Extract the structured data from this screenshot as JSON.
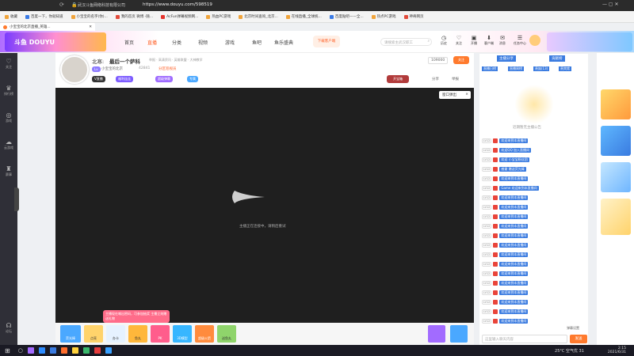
{
  "browser": {
    "url": "https://www.douyu.com/598519",
    "company": "武汉斗鱼网络科技有限公司"
  },
  "bookmarks": [
    "收藏",
    "百度一下，你就知道",
    "小宝宝的名字(你)...",
    "我的首页 微博 -随...",
    "AcFun弹幕视频网...",
    "热血PC游戏",
    "北京时间查询_北京...",
    "在线直播_全球统...",
    "百度贴吧——全...",
    "热点PC游戏",
    "神奇网页"
  ],
  "tab": {
    "title": "小宝宝的北京直播_英雄..."
  },
  "site_nav": {
    "links": [
      "首页",
      "直播",
      "分类",
      "视频",
      "游戏",
      "鱼吧",
      "鱼乐盛典"
    ],
    "search_placeholder": "请搜索主武汉职工",
    "download": "下载客户端",
    "icons": [
      "历史",
      "关注",
      "开播",
      "客户端",
      "消息",
      "任务中心"
    ]
  },
  "rail": [
    "关注",
    "排行榜",
    "游戏",
    "云游戏",
    "赛事",
    "论坛"
  ],
  "room": {
    "title_prefix": "北寒:",
    "title": "最后一个萨科",
    "subtitle": "举报 · 高清资讯 · 英雄联盟 · 大神教学",
    "streamer": "小宝宝的北京",
    "followers_label": "42841",
    "fans_badge": "分区巡视员",
    "follow_button": "关注",
    "fans_count": "109000",
    "share": "分享",
    "report": "举报",
    "live_badge": "V直播",
    "tags": [
      "福利连连",
      "超级弹幕",
      "专属"
    ],
    "treasure": "开宝箱"
  },
  "player": {
    "popout": "窗口弹出",
    "close": "×",
    "loading_text": "主播正在连接中，请稍后重试",
    "promo": "主播现在喊出密码，可参加抽奖 主播立刻赠送礼物"
  },
  "gifts": [
    "荧光棒",
    "点亮",
    "办卡",
    "鱼丸",
    "PK",
    "3D模型",
    "超级火箭",
    "送鱼丸"
  ],
  "chat": {
    "notice": "近期暂无主播公告",
    "tabs": [
      "主播分享",
      "贡献榜"
    ],
    "header_tags": [
      "直播日榜",
      "直播周榜",
      "贵族(13)",
      "贵宾席"
    ],
    "messages": [
      "欢迎来到本直播间",
      "欢迎QQ 加入直播间",
      "欢迎 小宝宝粉丝团",
      "感谢 赠送荧光棒",
      "欢迎来到本直播间",
      "Game 欢迎来到本直播间",
      "欢迎来到本直播间",
      "欢迎来到本直播间",
      "欢迎来到本直播间",
      "欢迎来到本直播间",
      "欢迎来到本直播间",
      "欢迎来到本直播间",
      "欢迎来到本直播间",
      "欢迎来到本直播间",
      "欢迎来到本直播间",
      "欢迎来到本直播间",
      "欢迎来到本直播间",
      "欢迎来到本直播间",
      "欢迎来到本直播间",
      "欢迎来到本直播间",
      "欢迎来到本直播间"
    ],
    "level_badge": "LV12",
    "input_placeholder": "这里输入聊天内容",
    "send": "发送",
    "footer": "弹幕设置"
  },
  "taskbar": {
    "weather": "25°C 空气优 31",
    "time": "2:15",
    "date": "2021/6/31"
  },
  "colors": {
    "brand_orange": "#ff7a2d",
    "chat_blue": "#3a7be0",
    "nav_active": "#ff5d23"
  }
}
